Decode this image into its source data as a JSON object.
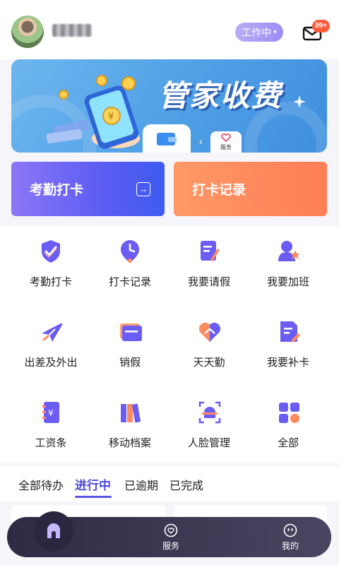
{
  "header": {
    "status_label": "工作中",
    "mail_badge": "99+"
  },
  "banner": {
    "title": "管家收费",
    "service_label": "服务"
  },
  "cards": {
    "checkin_label": "考勤打卡",
    "records_label": "打卡记录"
  },
  "grid": {
    "items": [
      {
        "label": "考勤打卡",
        "icon": "checkin-shield-icon"
      },
      {
        "label": "打卡记录",
        "icon": "clock-pin-icon"
      },
      {
        "label": "我要请假",
        "icon": "leave-form-icon"
      },
      {
        "label": "我要加班",
        "icon": "overtime-user-icon"
      },
      {
        "label": "出差及外出",
        "icon": "airplane-icon"
      },
      {
        "label": "销假",
        "icon": "cancel-leave-icon"
      },
      {
        "label": "天天勤",
        "icon": "handshake-heart-icon"
      },
      {
        "label": "我要补卡",
        "icon": "supplement-card-icon"
      },
      {
        "label": "工资条",
        "icon": "payslip-icon"
      },
      {
        "label": "移动档案",
        "icon": "archive-folders-icon"
      },
      {
        "label": "人脸管理",
        "icon": "face-scan-icon"
      },
      {
        "label": "全部",
        "icon": "all-apps-icon"
      }
    ]
  },
  "tabs": {
    "items": [
      "全部待办",
      "进行中",
      "已逾期",
      "已完成"
    ],
    "active": "进行中"
  },
  "nav": {
    "service_label": "服务",
    "mine_label": "我的"
  },
  "colors": {
    "accent": "#5b55e6",
    "orange": "#ff7e55",
    "badge": "#ff5b3a"
  }
}
